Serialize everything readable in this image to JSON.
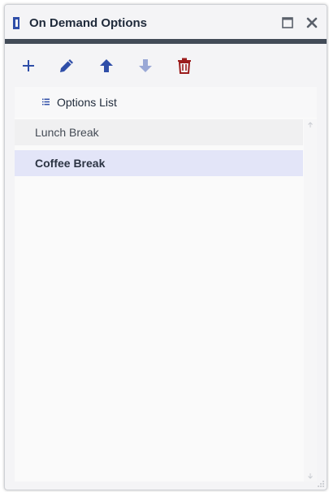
{
  "window": {
    "title": "On Demand Options",
    "icons": {
      "app": "dp-logo-icon",
      "maximize": "maximize-icon",
      "close": "close-icon"
    },
    "colors": {
      "brand": "#2f4ea8",
      "accent_bar": "#424b57",
      "selected_row": "#e3e5f8",
      "delete": "#9b1c1c"
    }
  },
  "toolbar": {
    "buttons": [
      {
        "name": "add",
        "icon": "plus-icon"
      },
      {
        "name": "edit",
        "icon": "pencil-icon"
      },
      {
        "name": "move-up",
        "icon": "arrow-up-icon"
      },
      {
        "name": "move-down",
        "icon": "arrow-down-icon",
        "disabled": true
      },
      {
        "name": "delete",
        "icon": "trash-icon"
      }
    ]
  },
  "list": {
    "header": "Options List",
    "header_icon": "list-icon",
    "items": [
      {
        "label": "Lunch Break",
        "selected": false
      },
      {
        "label": "Coffee Break",
        "selected": true
      }
    ]
  }
}
